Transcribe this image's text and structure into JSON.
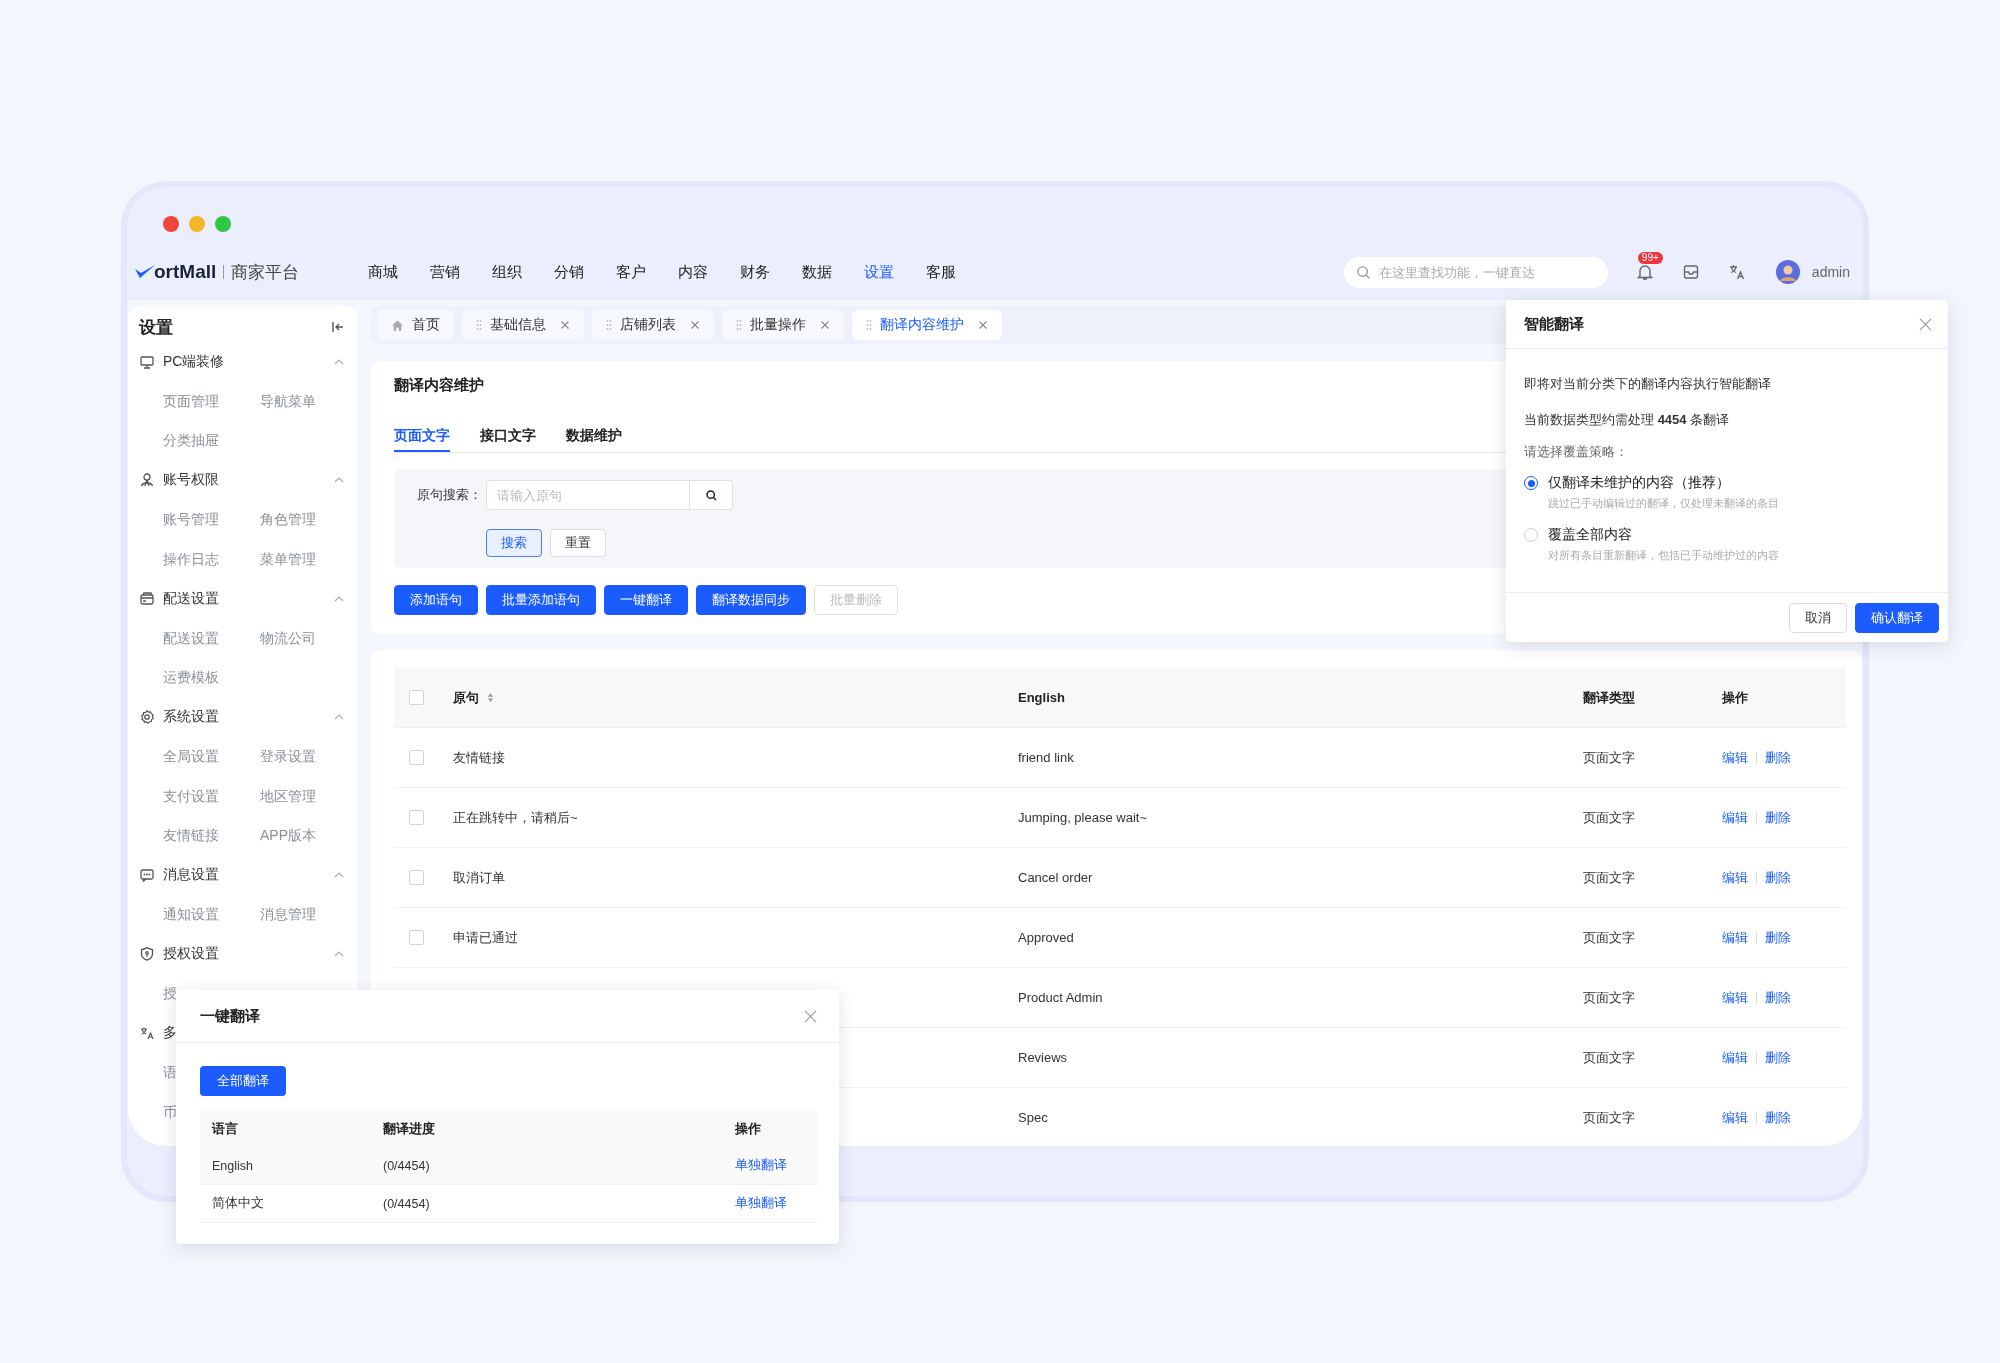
{
  "header": {
    "logo_text": "ortMall",
    "platform": "商家平台",
    "nav": [
      {
        "label": "商城",
        "selected": false
      },
      {
        "label": "营销",
        "selected": false
      },
      {
        "label": "组织",
        "selected": false
      },
      {
        "label": "分销",
        "selected": false
      },
      {
        "label": "客户",
        "selected": false
      },
      {
        "label": "内容",
        "selected": false
      },
      {
        "label": "财务",
        "selected": false
      },
      {
        "label": "数据",
        "selected": false
      },
      {
        "label": "设置",
        "selected": true
      },
      {
        "label": "客服",
        "selected": false
      }
    ],
    "search": {
      "placeholder": "在这里查找功能，一键直达"
    },
    "notification_badge": "99+",
    "user": "admin"
  },
  "sidebar": {
    "title": "设置",
    "groups": [
      {
        "label": "PC端装修",
        "expanded": true,
        "rows": [
          [
            "页面管理",
            "导航菜单"
          ],
          [
            "分类抽屉"
          ]
        ]
      },
      {
        "label": "账号权限",
        "expanded": true,
        "rows": [
          [
            "账号管理",
            "角色管理"
          ],
          [
            "操作日志",
            "菜单管理"
          ]
        ]
      },
      {
        "label": "配送设置",
        "expanded": true,
        "rows": [
          [
            "配送设置",
            "物流公司"
          ],
          [
            "运费模板"
          ]
        ]
      },
      {
        "label": "系统设置",
        "expanded": true,
        "rows": [
          [
            "全局设置",
            "登录设置"
          ],
          [
            "支付设置",
            "地区管理"
          ],
          [
            "友情链接",
            "APP版本"
          ]
        ]
      },
      {
        "label": "消息设置",
        "expanded": true,
        "rows": [
          [
            "通知设置",
            "消息管理"
          ]
        ]
      },
      {
        "label": "授权设置",
        "expanded": true,
        "rows": [
          [
            "授"
          ]
        ]
      },
      {
        "label": "多",
        "rows": [
          [
            "语"
          ],
          [
            "币"
          ]
        ]
      }
    ]
  },
  "tabs": [
    {
      "kind": "home",
      "label": "首页",
      "selected": false
    },
    {
      "kind": "page",
      "label": "基础信息",
      "selected": false
    },
    {
      "kind": "page",
      "label": "店铺列表",
      "selected": false
    },
    {
      "kind": "page",
      "label": "批量操作",
      "selected": false
    },
    {
      "kind": "page",
      "label": "翻译内容维护",
      "selected": true
    }
  ],
  "page": {
    "title": "翻译内容维护",
    "subtabs": [
      {
        "label": "页面文字",
        "selected": true
      },
      {
        "label": "接口文字",
        "selected": false
      },
      {
        "label": "数据维护",
        "selected": false
      }
    ],
    "filter": {
      "label": "原句搜索：",
      "placeholder": "请输入原句",
      "buttons": [
        {
          "label": "搜索",
          "kind": "primary-light"
        },
        {
          "label": "重置",
          "kind": "default"
        }
      ]
    },
    "actions": [
      {
        "label": "添加语句",
        "disabled": false
      },
      {
        "label": "批量添加语句",
        "disabled": false
      },
      {
        "label": "一键翻译",
        "disabled": false
      },
      {
        "label": "翻译数据同步",
        "disabled": false
      },
      {
        "label": "批量删除",
        "disabled": true
      }
    ]
  },
  "table": {
    "header_checked": false,
    "columns": [
      {
        "label": "原句",
        "sortable": true
      },
      {
        "label": "English"
      },
      {
        "label": "翻译类型"
      },
      {
        "label": "操作"
      }
    ],
    "rows": [
      {
        "checked": false,
        "original": "友情链接",
        "english": "friend link",
        "type": "页面文字",
        "actions": [
          "编辑",
          "删除"
        ]
      },
      {
        "checked": false,
        "original": "正在跳转中，请稍后~",
        "english": "Jumping, please wait~",
        "type": "页面文字",
        "actions": [
          "编辑",
          "删除"
        ]
      },
      {
        "checked": false,
        "original": "取消订单",
        "english": "Cancel order",
        "type": "页面文字",
        "actions": [
          "编辑",
          "删除"
        ]
      },
      {
        "checked": false,
        "original": "申请已通过",
        "english": "Approved",
        "type": "页面文字",
        "actions": [
          "编辑",
          "删除"
        ]
      },
      {
        "english": "Product Admin",
        "type": "页面文字",
        "actions": [
          "编辑",
          "删除"
        ]
      },
      {
        "english": "Reviews",
        "type": "页面文字",
        "actions": [
          "编辑",
          "删除"
        ]
      },
      {
        "english": "Spec",
        "type": "页面文字",
        "actions": [
          "编辑",
          "删除"
        ]
      }
    ]
  },
  "smart_translate_dialog": {
    "title": "智能翻译",
    "lines": [
      "即将对当前分类下的翻译内容执行智能翻译",
      "当前数据类型约需处理 **4454** 条翻译"
    ],
    "prompt": "请选择覆盖策略：",
    "options": [
      {
        "label": "仅翻译未维护的内容（推荐）",
        "description": "跳过已手动编辑过的翻译，仅处理未翻译的条目",
        "selected": true
      },
      {
        "label": "覆盖全部内容",
        "description": "对所有条目重新翻译，包括已手动维护过的内容",
        "selected": false
      }
    ],
    "buttons": [
      {
        "label": "取消",
        "kind": "default"
      },
      {
        "label": "确认翻译",
        "kind": "primary"
      }
    ]
  },
  "one_click_dialog": {
    "title": "一键翻译",
    "button": "全部翻译",
    "columns": [
      "语言",
      "翻译进度",
      "操作"
    ],
    "rows": [
      {
        "language": "English",
        "progress": "(0/4454)",
        "action": "单独翻译"
      },
      {
        "language": "简体中文",
        "progress": "(0/4454)",
        "action": "单独翻译"
      }
    ]
  }
}
